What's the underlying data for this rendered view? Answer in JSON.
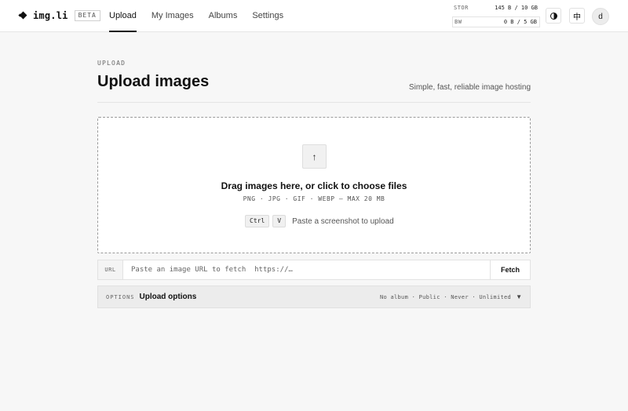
{
  "header": {
    "brand_name": "img.li",
    "brand_badge": "BETA",
    "nav": [
      {
        "label": "Upload",
        "active": true
      },
      {
        "label": "My Images",
        "active": false
      },
      {
        "label": "Albums",
        "active": false
      },
      {
        "label": "Settings",
        "active": false
      }
    ],
    "quota": {
      "storage_label": "STOR",
      "storage_value": "145 B / 10 GB",
      "bandwidth_label": "BW",
      "bandwidth_value": "0 B / 5 GB"
    },
    "language_button": "中",
    "avatar_initial": "d"
  },
  "page": {
    "eyebrow": "UPLOAD",
    "title": "Upload images",
    "tagline": "Simple, fast, reliable image hosting"
  },
  "dropzone": {
    "icon": "upload-arrow-icon",
    "icon_glyph": "↑",
    "title": "Drag images here, or click to choose files",
    "formats": "PNG · JPG · GIF · WEBP — MAX 20 MB",
    "key_ctrl": "Ctrl",
    "key_v": "V",
    "paste_hint": "Paste a screenshot to upload"
  },
  "url_fetch": {
    "label": "URL",
    "placeholder": "Paste an image URL to fetch  https://…",
    "button": "Fetch"
  },
  "options": {
    "tag": "OPTIONS",
    "title": "Upload options",
    "summary": "No album · Public · Never · Unlimited",
    "chevron": "▼"
  },
  "colors": {
    "accent": "#111111",
    "background": "#f7f7f7",
    "surface": "#ffffff"
  }
}
